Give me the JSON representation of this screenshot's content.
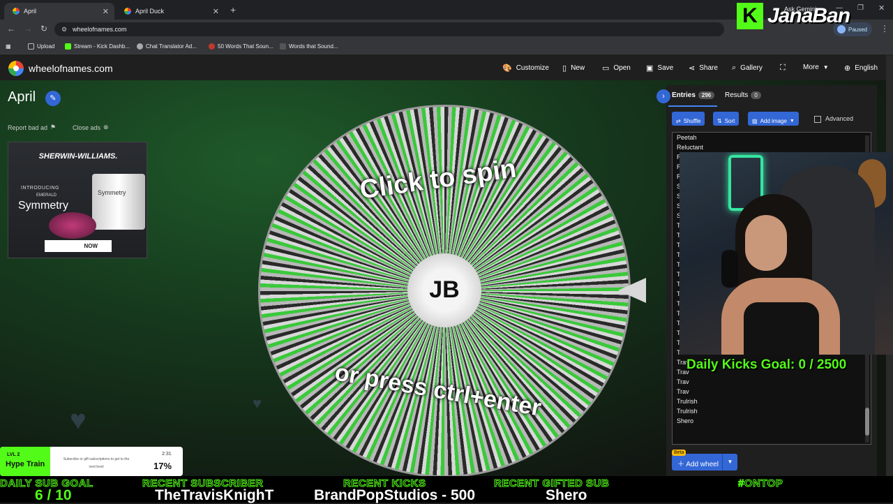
{
  "browser": {
    "tabs": [
      {
        "title": "April",
        "active": true
      },
      {
        "title": "April Duck",
        "active": false
      }
    ],
    "url": "wheelofnames.com",
    "profile_status": "Paused",
    "ask_gemini": "Ask Gemini",
    "bookmarks": [
      "Upload",
      "Stream - Kick Dashb...",
      "Chat Translator Ad...",
      "50 Words That Soun...",
      "Words that Sound..."
    ]
  },
  "overlay": {
    "kick_letter": "K",
    "streamer": "JanaBan",
    "goal": "Daily Kicks Goal: 0 / 2500",
    "hype": {
      "level": "LVL 2",
      "title": "Hype Train",
      "desc": "Subscribe or gift subscriptions to get to the next level",
      "time": "2:31",
      "percent": "17%"
    },
    "ticker": [
      {
        "label": "DAILY SUB GOAL",
        "value": "6 / 10"
      },
      {
        "label": "RECENT SUBSCRIBER",
        "value": "TheTravisKnighT"
      },
      {
        "label": "RECENT KICKS",
        "value": "BrandPopStudios - 500"
      },
      {
        "label": "RECENT GIFTED SUB",
        "value": "Shero"
      },
      {
        "label": "#ONTOP",
        "value": ""
      }
    ]
  },
  "app": {
    "site_name": "wheelofnames.com",
    "menu": [
      "Customize",
      "New",
      "Open",
      "Save",
      "Share",
      "Gallery",
      "",
      "More",
      "English"
    ],
    "wheel_title": "April",
    "report_ad": "Report bad ad",
    "close_ads": "Close ads",
    "ad": {
      "brand": "SHERWIN-WILLIAMS.",
      "intro": "INTRODUCING",
      "emerald": "EMERALD",
      "product": "Symmetry",
      "cta": "NOW"
    },
    "wheel": {
      "line1": "Click to spin",
      "line2": "or press ctrl+enter"
    },
    "panel": {
      "tab_entries": "Entries",
      "entries_count": "296",
      "tab_results": "Results",
      "results_count": "0",
      "shuffle": "Shuffle",
      "sort": "Sort",
      "add_image": "Add image",
      "advanced": "Advanced",
      "entries": [
        "Peetah",
        "Reluctant",
        "R",
        "R",
        "R",
        "S",
        "S",
        "S",
        "S",
        "T",
        "T",
        "T",
        "T",
        "T",
        "T",
        "Tr",
        "Tr",
        "Tr",
        "Tr",
        "Tr",
        "Trav",
        "Trav",
        "Trav",
        "Trav",
        "Trav",
        "Trav",
        "Trav",
        "Trulrish",
        "Trulrish",
        "Shero"
      ],
      "beta": "Beta",
      "add_wheel": "Add wheel"
    }
  },
  "colors": {
    "kick_green": "#53fc18",
    "accent_blue": "#3367d6",
    "wheel_green": "#3ac93a"
  }
}
